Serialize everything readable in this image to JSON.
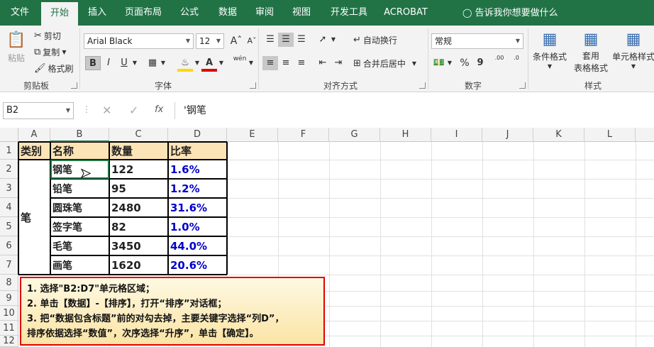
{
  "tabs": [
    {
      "label": "文件"
    },
    {
      "label": "开始"
    },
    {
      "label": "插入"
    },
    {
      "label": "页面布局"
    },
    {
      "label": "公式"
    },
    {
      "label": "数据"
    },
    {
      "label": "审阅"
    },
    {
      "label": "视图"
    },
    {
      "label": "开发工具"
    },
    {
      "label": "ACROBAT"
    }
  ],
  "tell_me": "告诉我你想要做什么",
  "ribbon": {
    "paste": "粘贴",
    "cut": "剪切",
    "copy": "复制",
    "format_painter": "格式刷",
    "clipboard_group": "剪贴板",
    "font_name": "Arial Black",
    "font_size": "12",
    "bold": "B",
    "italic": "I",
    "underline": "U",
    "font_group": "字体",
    "wrap_text": "自动换行",
    "merge_center": "合并后居中",
    "align_group": "对齐方式",
    "number_format": "常规",
    "percent": "%",
    "comma": "9",
    "number_group": "数字",
    "conditional_format": "条件格式",
    "table_format_1": "套用",
    "table_format_2": "表格格式",
    "cell_styles": "单元格样式",
    "styles_group": "样式",
    "phonetic": "wén",
    "inc_decimal": ".00",
    "dec_decimal": ".0"
  },
  "formula_bar": {
    "name_box": "B2",
    "fx": "fx",
    "content": "'钢笔"
  },
  "columns": [
    "A",
    "B",
    "C",
    "D",
    "E",
    "F",
    "G",
    "H",
    "I",
    "J",
    "K",
    "L"
  ],
  "rows": [
    "1",
    "2",
    "3",
    "4",
    "5",
    "6",
    "7",
    "8",
    "9",
    "10",
    "11",
    "12"
  ],
  "table": {
    "headers": [
      "类别",
      "名称",
      "数量",
      "比率"
    ],
    "category": "笔",
    "names": [
      "钢笔",
      "铅笔",
      "圆珠笔",
      "签字笔",
      "毛笔",
      "画笔"
    ],
    "quantities": [
      "122",
      "95",
      "2480",
      "82",
      "3450",
      "1620"
    ],
    "ratios": [
      "1.6%",
      "1.2%",
      "31.6%",
      "1.0%",
      "44.0%",
      "20.6%"
    ]
  },
  "note": {
    "line1": "1. 选择\"B2:D7\"单元格区域；",
    "line2": "2. 单击【数据】-【排序】，打开“排序”对话框；",
    "line3": "3. 把“数据包含标题”前的对勾去掉，主要关键字选择“列D”，",
    "line4": "排序依据选择“数值”，次序选择“升序”，单击【确定】。"
  },
  "colors": {
    "excel_green": "#217346",
    "header_fill": "#fce4b6",
    "ratio_blue": "#0000cc",
    "note_border": "#e00000"
  }
}
